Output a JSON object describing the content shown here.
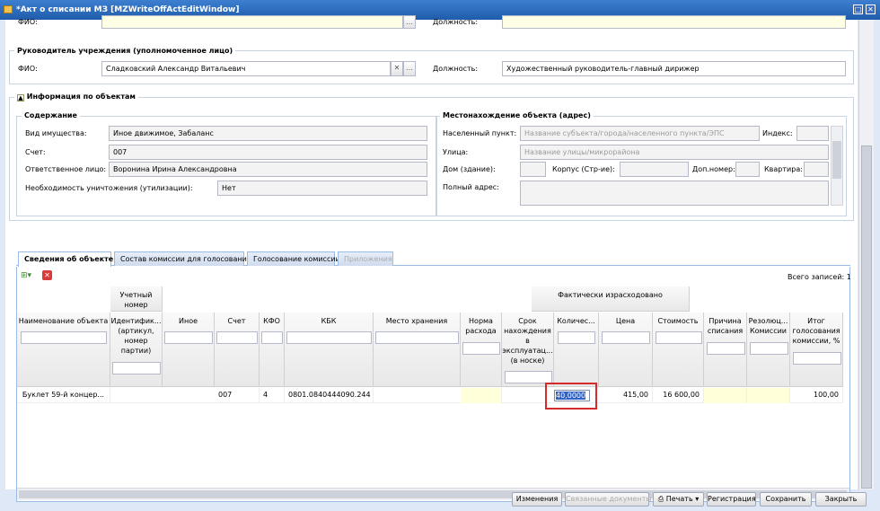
{
  "window": {
    "title": "*Акт о списании МЗ [MZWriteOffActEditWindow]"
  },
  "top": {
    "fio_label": "ФИО:",
    "position_label": "Должность:"
  },
  "head": {
    "legend": "Руководитель учреждения (уполномоченное лицо)",
    "fio_label": "ФИО:",
    "fio_value": "Сладковский Александр Витальевич",
    "position_label": "Должность:",
    "position_value": "Художественный руководитель-главный дирижер"
  },
  "objinfo": {
    "legend": "Информация по объектам",
    "content": {
      "legend": "Содержание",
      "property_label": "Вид имущества:",
      "property_value": "Иное движимое, Забаланс",
      "account_label": "Счет:",
      "account_value": "007",
      "responsible_label": "Ответственное лицо:",
      "responsible_value": "Воронина Ирина Александровна",
      "destroy_label": "Необходимость уничтожения (утилизации):",
      "destroy_value": "Нет"
    },
    "location": {
      "legend": "Местонахождение объекта (адрес)",
      "locality_label": "Населенный пункт:",
      "locality_placeholder": "Название субъекта/города/населенного пункта/ЭПС",
      "index_label": "Индекс:",
      "street_label": "Улица:",
      "street_placeholder": "Название улицы/микрорайона",
      "house_label": "Дом (здание):",
      "building_label": "Корпус (Стр-ие):",
      "extra_label": "Доп.номер:",
      "apt_label": "Квартира:",
      "full_label": "Полный адрес:"
    }
  },
  "tabs": [
    "Сведения об объекте",
    "Состав комиссии для голосования",
    "Голосование комиссии",
    "Приложения"
  ],
  "grid": {
    "total": "Всего записей: 1",
    "group_account": "Учетный номер",
    "group_fact": "Фактически израсходовано",
    "columns": [
      "Наименование объекта",
      "Идентифик... (артикул, номер партии)",
      "Иное",
      "Счет",
      "КФО",
      "КБК",
      "Место хранения",
      "Норма расхода",
      "Срок нахождения в эксплуатац... (в носке)",
      "Количес...",
      "Цена",
      "Стоимость",
      "Причина списания",
      "Резолюц... Комиссии",
      "Итог голосования комиссии, %"
    ],
    "row": {
      "name": "Буклет 59-й концер...",
      "account": "007",
      "kfo": "4",
      "kbk": "0801.0840444090.244",
      "qty": "40,0000",
      "price": "415,00",
      "cost": "16 600,00",
      "result": "100,00"
    }
  },
  "buttons": {
    "changes": "Изменения",
    "related": "Связанные документы",
    "print": "Печать",
    "register": "Регистрация",
    "save": "Сохранить",
    "close": "Закрыть"
  }
}
